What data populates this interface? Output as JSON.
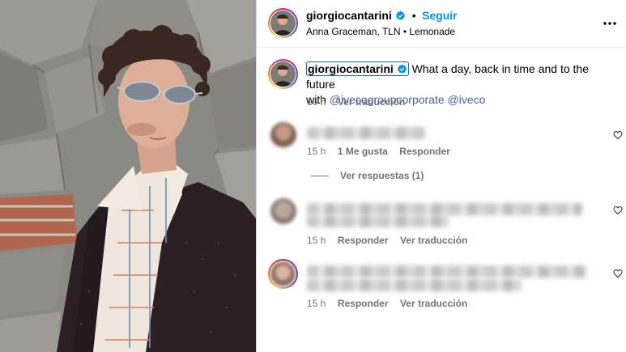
{
  "header": {
    "username": "giorgiocantarini",
    "separator": "•",
    "follow_label": "Seguir",
    "audio": "Anna Graceman, TLN • Lemonade"
  },
  "caption": {
    "username": "giorgiocantarini",
    "text": " What a day, back in time and to the future",
    "with_word": "with ",
    "mention_1": "@ivecogroupcorporate",
    "mention_2": "@iveco",
    "time": "16 h",
    "translate_label": "Ver traducción"
  },
  "comments": [
    {
      "time": "15 h",
      "likes": "1 Me gusta",
      "reply_label": "Responder"
    },
    {
      "time": "15 h",
      "reply_label": "Responder",
      "translate_label": "Ver traducción"
    },
    {
      "time": "15 h",
      "reply_label": "Responder",
      "translate_label": "Ver traducción"
    }
  ],
  "view_replies_label": "Ver respuestas (1)",
  "icons": {
    "verified": "verified-badge-icon",
    "more": "more-options-icon",
    "like": "heart-icon"
  },
  "colors": {
    "follow": "#0095f6",
    "verified": "#0095f6",
    "mention": "#4a5cb6",
    "muted": "#737373"
  }
}
